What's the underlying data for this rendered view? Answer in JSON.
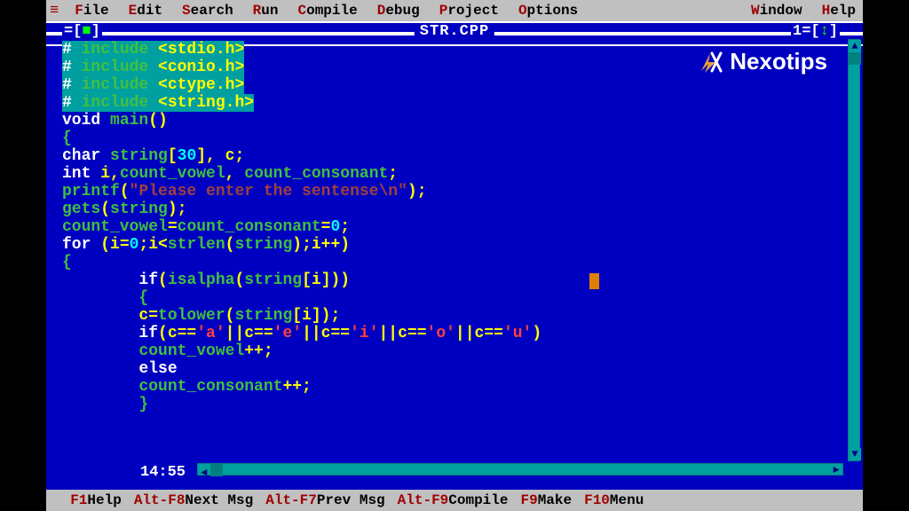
{
  "menu": {
    "items": [
      "File",
      "Edit",
      "Search",
      "Run",
      "Compile",
      "Debug",
      "Project",
      "Options"
    ],
    "right_items": [
      "Window",
      "Help"
    ]
  },
  "window": {
    "title": "STR.CPP",
    "number": "1",
    "cursor_pos": "14:55"
  },
  "code": {
    "lines": [
      {
        "t": "# include <stdio.h>",
        "hl": true
      },
      {
        "t": "# include <conio.h>",
        "hl": true
      },
      {
        "t": "# include <ctype.h>",
        "hl": true
      },
      {
        "t": "# include <string.h>",
        "hl": true
      },
      {
        "segments": [
          [
            "ty",
            "void "
          ],
          [
            "fn",
            "main"
          ],
          [
            "id",
            "()"
          ]
        ]
      },
      {
        "segments": [
          [
            "br",
            "{"
          ]
        ]
      },
      {
        "segments": [
          [
            "ty",
            "char "
          ],
          [
            "fn",
            "string"
          ],
          [
            "id",
            "["
          ],
          [
            "num",
            "30"
          ],
          [
            "id",
            "], c;"
          ]
        ]
      },
      {
        "segments": [
          [
            "ty",
            "int "
          ],
          [
            "id",
            "i,"
          ],
          [
            "fn",
            "count_vowel"
          ],
          [
            "id",
            ", "
          ],
          [
            "fn",
            "count_consonant"
          ],
          [
            "id",
            ";"
          ]
        ]
      },
      {
        "segments": [
          [
            "fn",
            "printf"
          ],
          [
            "id",
            "("
          ],
          [
            "str",
            "\"Please enter the sentense\\n\""
          ],
          [
            "id",
            ");"
          ]
        ]
      },
      {
        "segments": [
          [
            "fn",
            "gets"
          ],
          [
            "id",
            "("
          ],
          [
            "fn",
            "string"
          ],
          [
            "id",
            ");"
          ]
        ]
      },
      {
        "segments": [
          [
            "fn",
            "count_vowel"
          ],
          [
            "id",
            "="
          ],
          [
            "fn",
            "count_consonant"
          ],
          [
            "id",
            "="
          ],
          [
            "num",
            "0"
          ],
          [
            "id",
            ";"
          ]
        ]
      },
      {
        "segments": [
          [
            "ty",
            "for "
          ],
          [
            "id",
            "(i="
          ],
          [
            "num",
            "0"
          ],
          [
            "id",
            ";i<"
          ],
          [
            "fn",
            "strlen"
          ],
          [
            "id",
            "("
          ],
          [
            "fn",
            "string"
          ],
          [
            "id",
            ");i++)"
          ]
        ]
      },
      {
        "segments": [
          [
            "br",
            "{"
          ]
        ]
      },
      {
        "segments": [
          [
            "id",
            "        "
          ],
          [
            "ty",
            "if"
          ],
          [
            "id",
            "("
          ],
          [
            "fn",
            "isalpha"
          ],
          [
            "id",
            "("
          ],
          [
            "fn",
            "string"
          ],
          [
            "id",
            "[i]))"
          ]
        ]
      },
      {
        "segments": [
          [
            "id",
            "        "
          ],
          [
            "br",
            "{"
          ]
        ]
      },
      {
        "segments": [
          [
            "id",
            "        c="
          ],
          [
            "fn",
            "tolower"
          ],
          [
            "id",
            "("
          ],
          [
            "fn",
            "string"
          ],
          [
            "id",
            "[i]);"
          ]
        ]
      },
      {
        "segments": [
          [
            "id",
            "        "
          ],
          [
            "ty",
            "if"
          ],
          [
            "id",
            "(c=="
          ],
          [
            "chr",
            "'a'"
          ],
          [
            "id",
            "||c=="
          ],
          [
            "chr",
            "'e'"
          ],
          [
            "id",
            "||c=="
          ],
          [
            "chr",
            "'i'"
          ],
          [
            "id",
            "||c=="
          ],
          [
            "chr",
            "'o'"
          ],
          [
            "id",
            "||c=="
          ],
          [
            "chr",
            "'u'"
          ],
          [
            "id",
            ")"
          ]
        ]
      },
      {
        "segments": [
          [
            "id",
            "        "
          ],
          [
            "fn",
            "count_vowel"
          ],
          [
            "id",
            "++;"
          ]
        ]
      },
      {
        "segments": [
          [
            "id",
            "        "
          ],
          [
            "ty",
            "else"
          ]
        ]
      },
      {
        "segments": [
          [
            "id",
            "        "
          ],
          [
            "fn",
            "count_consonant"
          ],
          [
            "id",
            "++;"
          ]
        ]
      },
      {
        "segments": [
          [
            "id",
            "        "
          ],
          [
            "br",
            "}"
          ]
        ]
      }
    ]
  },
  "shortcuts": [
    {
      "key": "F1",
      "label": "Help"
    },
    {
      "key": "Alt-F8",
      "label": "Next Msg"
    },
    {
      "key": "Alt-F7",
      "label": "Prev Msg"
    },
    {
      "key": "Alt-F9",
      "label": "Compile"
    },
    {
      "key": "F9",
      "label": "Make"
    },
    {
      "key": "F10",
      "label": "Menu"
    }
  ],
  "watermark": "Nexotips"
}
